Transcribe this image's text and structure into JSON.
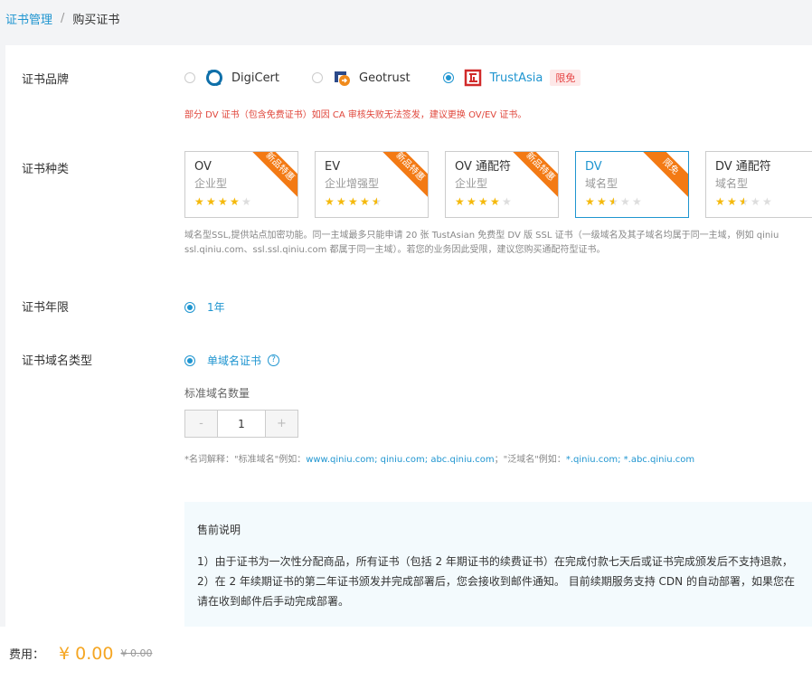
{
  "breadcrumb": {
    "parent": "证书管理",
    "separator": "/",
    "current": "购买证书"
  },
  "brand": {
    "label": "证书品牌",
    "options": [
      {
        "name": "DigiCert",
        "selected": false,
        "icon": "digicert-logo-icon"
      },
      {
        "name": "Geotrust",
        "selected": false,
        "icon": "geotrust-logo-icon"
      },
      {
        "name": "TrustAsia",
        "selected": true,
        "icon": "trustasia-logo-icon",
        "badge": "限免"
      }
    ],
    "warning": "部分 DV 证书（包含免费证书）如因 CA 审核失败无法签发，建议更换 OV/EV 证书。"
  },
  "type": {
    "label": "证书种类",
    "cards": [
      {
        "title": "OV",
        "subtitle": "企业型",
        "rating": 4,
        "ribbon": "新品特惠",
        "selected": false
      },
      {
        "title": "EV",
        "subtitle": "企业增强型",
        "rating": 4.5,
        "ribbon": "新品特惠",
        "selected": false
      },
      {
        "title": "OV 通配符",
        "subtitle": "企业型",
        "rating": 4,
        "ribbon": "新品特惠",
        "selected": false
      },
      {
        "title": "DV",
        "subtitle": "域名型",
        "rating": 2.5,
        "ribbon": "限免",
        "selected": true
      },
      {
        "title": "DV 通配符",
        "subtitle": "域名型",
        "rating": 2.5,
        "ribbon": "",
        "selected": false
      }
    ],
    "desc_line1": "域名型SSL,提供站点加密功能。同一主域最多只能申请 20 张 TustAsian 免费型 DV 版 SSL 证书（一级域名及其子域名均属于同一主域，例如 qiniu",
    "desc_line2": "ssl.qiniu.com、ssl.ssl.qiniu.com 都属于同一主域）。若您的业务因此受限，建议您购买通配符型证书。"
  },
  "year": {
    "label": "证书年限",
    "option": "1年"
  },
  "domain": {
    "label": "证书域名类型",
    "option": "单域名证书",
    "help": "?",
    "qty_label": "标准域名数量",
    "qty_value": "1",
    "minus": "-",
    "plus": "+",
    "note_prefix": "*名词解释：\"标准域名\"例如：",
    "note_std": "www.qiniu.com; qiniu.com; abc.qiniu.com",
    "note_mid": "；\"泛域名\"例如：",
    "note_wild": "*.qiniu.com; *.abc.qiniu.com"
  },
  "presale": {
    "title": "售前说明",
    "line1": "1）由于证书为一次性分配商品，所有证书（包括 2 年期证书的续费证书）在完成付款七天后或证书完成颁发后不支持退款，",
    "line2": "2）在 2 年续期证书的第二年证书颁发并完成部署后，您会接收到邮件通知。 目前续期服务支持 CDN 的自动部署，如果您在",
    "line3": "请在收到邮件后手动完成部署。"
  },
  "footer": {
    "label": "费用：",
    "price": "¥ 0.00",
    "original": "¥ 0.00"
  },
  "colors": {
    "accent": "#1f95d0",
    "ribbon": "#f37a14",
    "warning": "#e0463b",
    "price": "#f5a623"
  }
}
